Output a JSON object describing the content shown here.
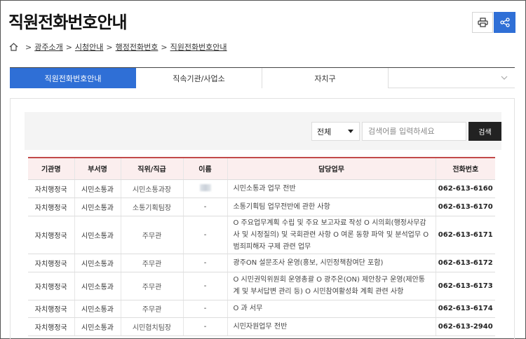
{
  "page": {
    "title": "직원전화번호안내"
  },
  "breadcrumb": [
    "광주소개",
    "시청안내",
    "행정전화번호",
    "직원전화번호안내"
  ],
  "tabs": [
    {
      "label": "직원전화번호안내",
      "active": true
    },
    {
      "label": "직속기관/사업소",
      "active": false
    },
    {
      "label": "자치구",
      "active": false
    }
  ],
  "search": {
    "select_value": "전체",
    "placeholder": "검색어를 입력하세요",
    "button_label": "검색"
  },
  "table": {
    "headers": [
      "기관명",
      "부서명",
      "직위/직급",
      "이름",
      "담당업무",
      "전화번호"
    ],
    "rows": [
      {
        "org": "자치행정국",
        "dept": "시민소통과",
        "position": "시민소통과장",
        "name": "",
        "duty": "시민소통과 업무 전반",
        "phone": "062-613-6160"
      },
      {
        "org": "자치행정국",
        "dept": "시민소통과",
        "position": "소통기획팀장",
        "name": "-",
        "duty": "소통기획팀 업무전반에 관한 사항",
        "phone": "062-613-6170"
      },
      {
        "org": "자치행정국",
        "dept": "시민소통과",
        "position": "주무관",
        "name": "-",
        "duty": "O 주요업무계획 수립 및 주요 보고자료 작성 O 시의회(행정사무감사 및 시정질의) 및 국회관련 사항 O 여론 동향 파악 및 분석업무 O 범죄피해자 구제 관련 업무",
        "phone": "062-613-6171"
      },
      {
        "org": "자치행정국",
        "dept": "시민소통과",
        "position": "주무관",
        "name": "-",
        "duty": "광주ON 설문조사 운영(홍보, 시민정책참여단 포함)",
        "phone": "062-613-6172"
      },
      {
        "org": "자치행정국",
        "dept": "시민소통과",
        "position": "주무관",
        "name": "-",
        "duty": "O 시민권익위원회 운영총괄 O 광주온(ON) 제안창구 운영(제안통계 및 부서답변 관리 등) O 시민참여활성화 계획 관련 사항",
        "phone": "062-613-6173"
      },
      {
        "org": "자치행정국",
        "dept": "시민소통과",
        "position": "주무관",
        "name": "-",
        "duty": "O 과 서무",
        "phone": "062-613-6174"
      },
      {
        "org": "자치행정국",
        "dept": "시민소통과",
        "position": "시민협치팀장",
        "name": "-",
        "duty": "시민자원업무 전반",
        "phone": "062-613-2940"
      }
    ]
  },
  "colors": {
    "accent": "#2f6fd6",
    "table_header_bg": "#fbeeee",
    "table_header_border": "#c24a4a"
  },
  "icons": {
    "print": "printer-icon",
    "share": "share-icon",
    "home": "home-icon",
    "more": "chevron-down-icon"
  }
}
